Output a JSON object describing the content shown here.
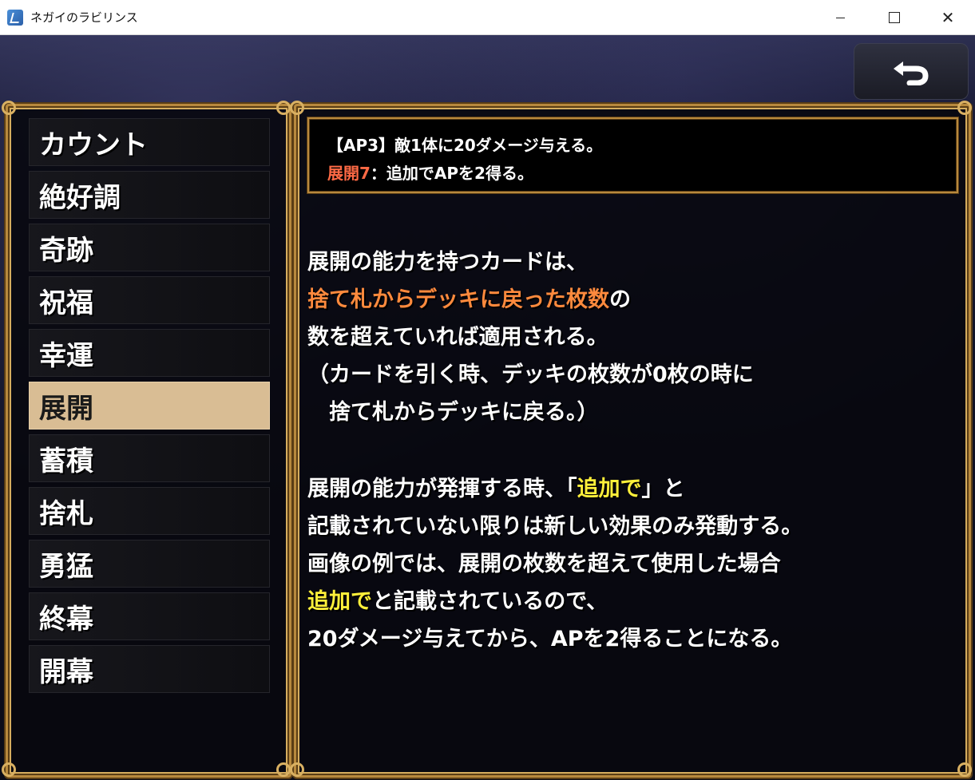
{
  "window": {
    "title": "ネガイのラビリンス",
    "minimize_label": "",
    "close_label": "✕"
  },
  "back_button": {
    "icon": "undo-arrow-icon"
  },
  "menu": [
    {
      "label": "カウント",
      "selected": false
    },
    {
      "label": "絶好調",
      "selected": false
    },
    {
      "label": "奇跡",
      "selected": false
    },
    {
      "label": "祝福",
      "selected": false
    },
    {
      "label": "幸運",
      "selected": false
    },
    {
      "label": "展開",
      "selected": true
    },
    {
      "label": "蓄積",
      "selected": false
    },
    {
      "label": "捨札",
      "selected": false
    },
    {
      "label": "勇猛",
      "selected": false
    },
    {
      "label": "終幕",
      "selected": false
    },
    {
      "label": "開幕",
      "selected": false
    }
  ],
  "card_example": {
    "line1": "【AP3】敵1体に20ダメージ与える。",
    "keyword": "展開7",
    "line2_rest": "：追加でAPを2得る。"
  },
  "description": {
    "p1_line1": "展開の能力を持つカードは、",
    "p1_line2_highlight": "捨て札からデッキに戻った枚数",
    "p1_line2_rest": "の",
    "p1_line3": "数を超えていれば適用される。",
    "p1_line4": "（カードを引く時、デッキの枚数が0枚の時に",
    "p1_line5": "　捨て札からデッキに戻る。）",
    "p2_line1_pre": "展開の能力が発揮する時、「",
    "p2_line1_highlight": "追加で",
    "p2_line1_post": "」と",
    "p2_line2": "記載されていない限りは新しい効果のみ発動する。",
    "p2_line3": "画像の例では、展開の枚数を超えて使用した場合",
    "p2_line4_highlight": "追加で",
    "p2_line4_rest": "と記載されているので、",
    "p2_line5": "20ダメージ与えてから、APを2得ることになる。"
  },
  "colors": {
    "gold_frame": "#b8893d",
    "selected_bg": "#d9bd94",
    "keyword_red": "#ff6a45",
    "highlight_orange": "#ff8a3d",
    "highlight_yellow": "#fff03a"
  }
}
